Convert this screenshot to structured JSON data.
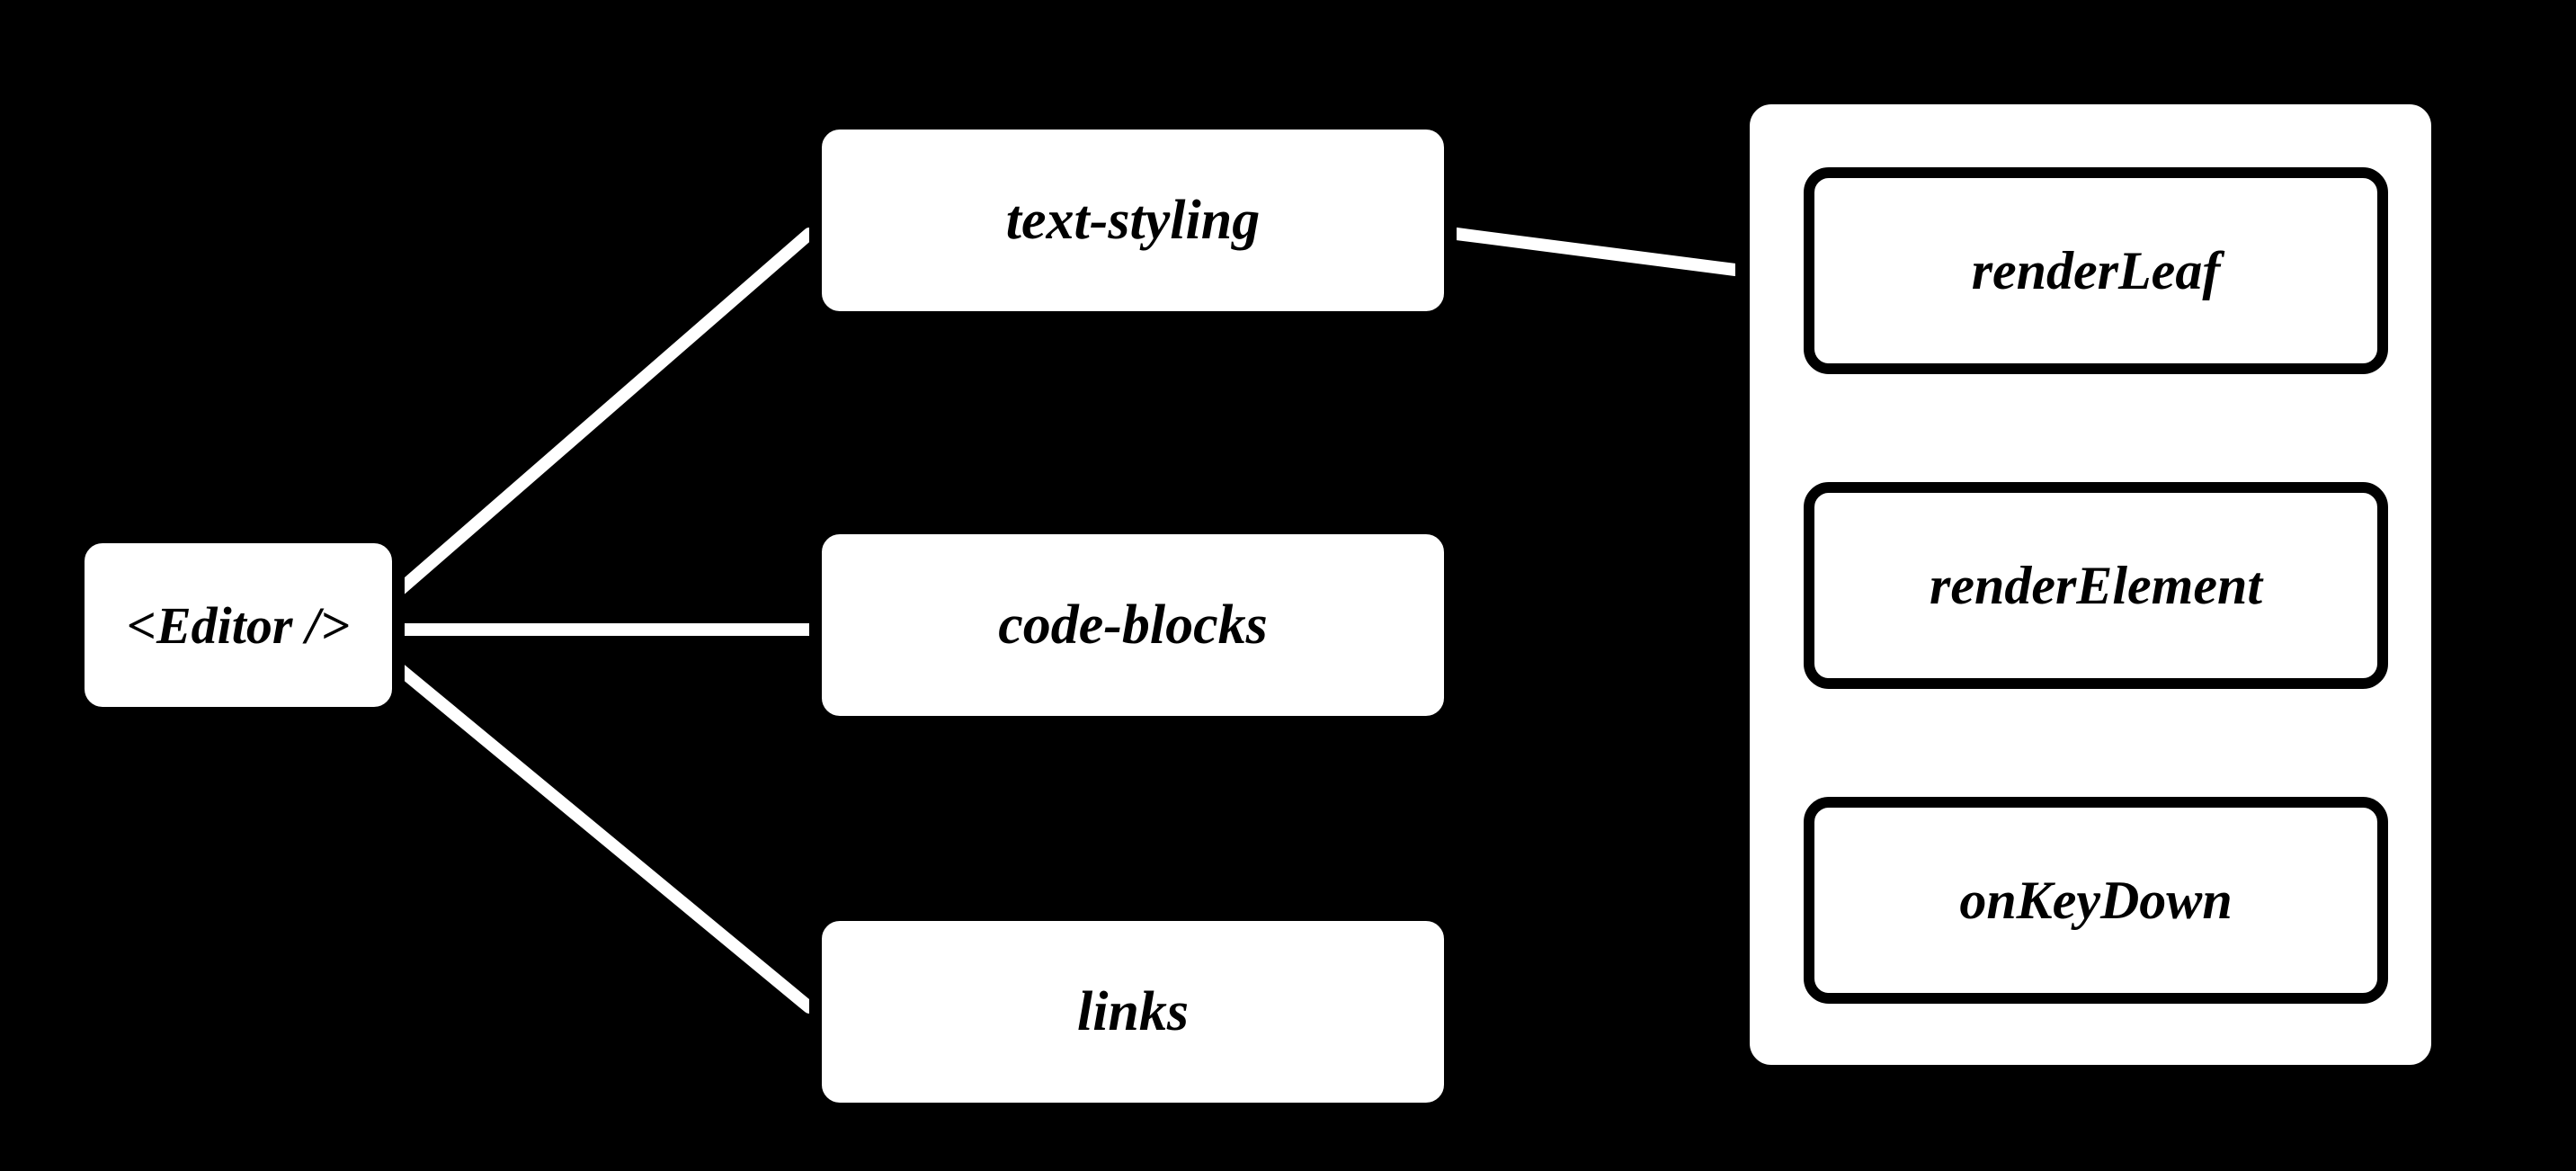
{
  "diagram": {
    "root": {
      "label": "<Editor />"
    },
    "plugins": [
      {
        "label": "text-styling"
      },
      {
        "label": "code-blocks"
      },
      {
        "label": "links"
      }
    ],
    "detail": {
      "items": [
        {
          "label": "renderLeaf"
        },
        {
          "label": "renderElement"
        },
        {
          "label": "onKeyDown"
        }
      ]
    }
  }
}
